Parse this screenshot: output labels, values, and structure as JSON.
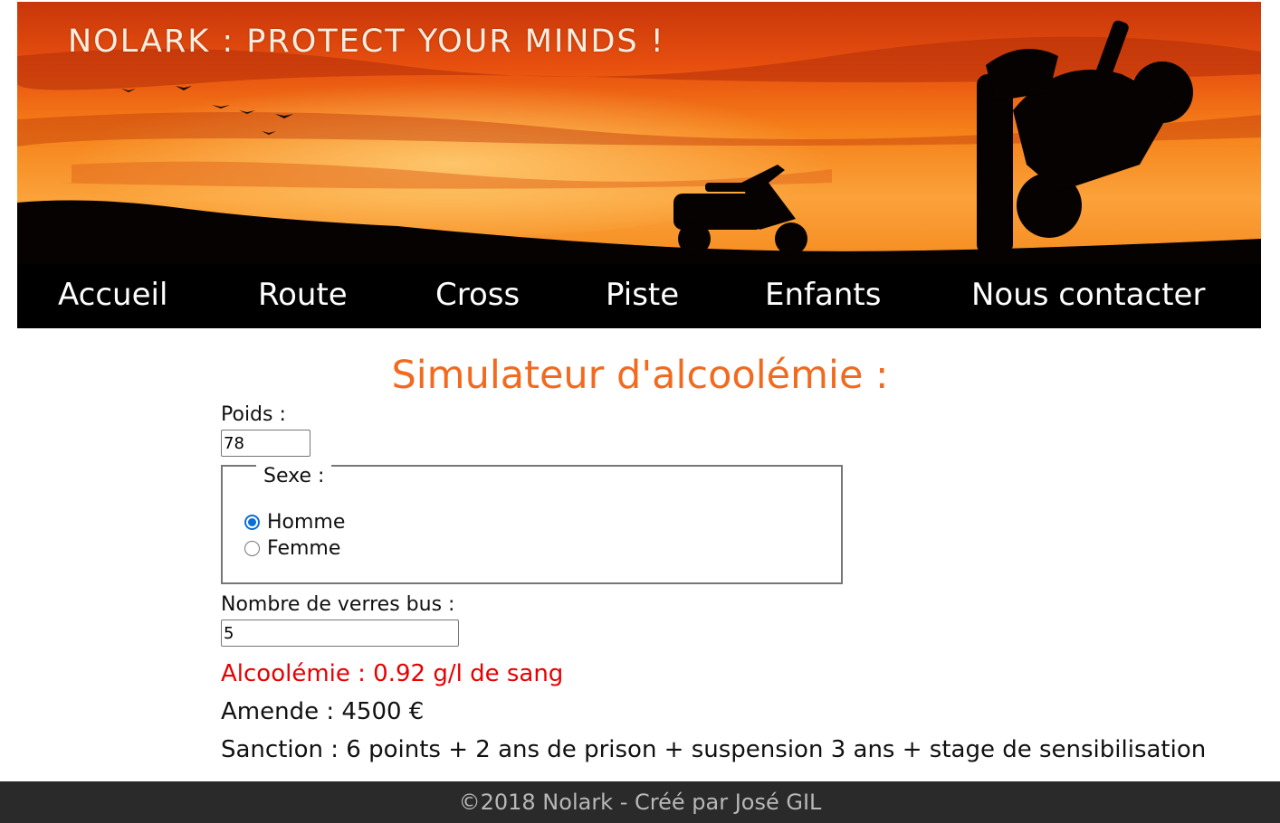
{
  "header": {
    "title": "NOLARK : PROTECT YOUR MINDS !"
  },
  "nav": {
    "items": [
      {
        "label": "Accueil"
      },
      {
        "label": "Route"
      },
      {
        "label": "Cross"
      },
      {
        "label": "Piste"
      },
      {
        "label": "Enfants"
      },
      {
        "label": "Nous contacter"
      }
    ]
  },
  "main": {
    "title": "Simulateur d'alcoolémie :",
    "poids_label": "Poids :",
    "poids_value": "78",
    "sexe_legend": "Sexe :",
    "sexe_options": [
      {
        "label": "Homme",
        "checked": true
      },
      {
        "label": "Femme",
        "checked": false
      }
    ],
    "verres_label": "Nombre de verres bus :",
    "verres_value": "5",
    "alcoolemie": "Alcoolémie : 0.92 g/l de sang",
    "amende": "Amende : 4500 €",
    "sanction": "Sanction : 6 points + 2 ans de prison + suspension 3 ans + stage de sensibilisation"
  },
  "footer": {
    "text": "©2018 Nolark - Créé par José GIL"
  },
  "colors": {
    "accent": "#f26a1f",
    "alcoolemie": "#e80000",
    "radio_checked": "#0b6fd6",
    "footer_bg": "#2a2a2a"
  }
}
